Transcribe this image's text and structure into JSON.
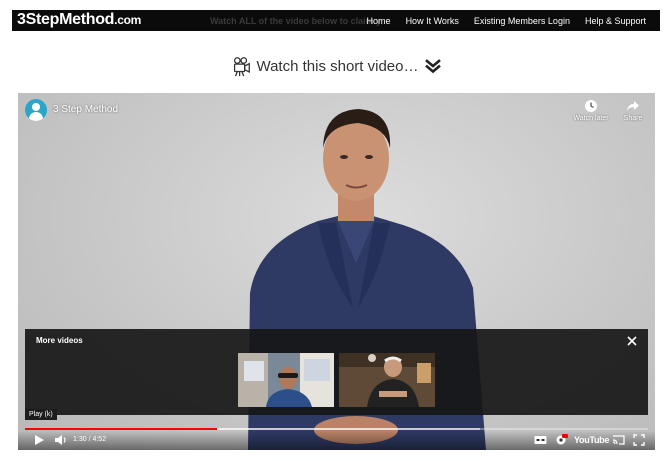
{
  "site": {
    "logo_main": "3StepMethod",
    "logo_suffix": ".com",
    "ghost_text": "Watch ALL of the video below to claim y"
  },
  "nav": {
    "items": [
      {
        "label": "Home"
      },
      {
        "label": "How It Works"
      },
      {
        "label": "Existing Members Login"
      },
      {
        "label": "Help & Support"
      }
    ]
  },
  "heading": {
    "text": "Watch this short video…"
  },
  "video": {
    "channel_name": "3 Step Method",
    "watch_later_label": "Watch later",
    "share_label": "Share",
    "more_videos_title": "More videos",
    "tooltip": "Play (k)",
    "current_time": "1:30",
    "duration": "4:52",
    "time_display": "1:30 / 4:52",
    "played_fraction": 0.308,
    "loaded_fraction": 0.73,
    "youtube_label": "YouTube"
  },
  "colors": {
    "nav_bg": "#0b0b0b",
    "progress_played": "#ff0000",
    "channel_avatar": "#2aa6c9"
  }
}
